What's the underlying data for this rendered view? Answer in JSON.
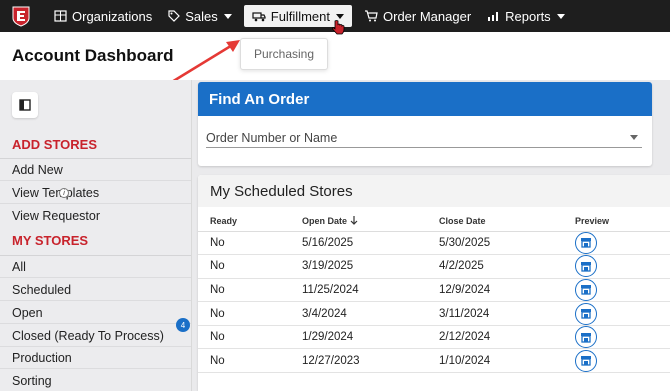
{
  "topnav": {
    "items": [
      {
        "label": "Organizations",
        "icon": "building-icon",
        "has_caret": false
      },
      {
        "label": "Sales",
        "icon": "tag-icon",
        "has_caret": true
      },
      {
        "label": "Fulfillment",
        "icon": "truck-icon",
        "has_caret": true,
        "active": true
      },
      {
        "label": "Order Manager",
        "icon": "cart-icon",
        "has_caret": false
      },
      {
        "label": "Reports",
        "icon": "chart-icon",
        "has_caret": true
      }
    ]
  },
  "dropdown": {
    "items": [
      "Purchasing"
    ]
  },
  "header": {
    "title": "Account Dashboard"
  },
  "sidebar": {
    "add_stores_heading": "ADD STORES",
    "add_stores": [
      "Add New",
      "View Templates",
      "View Requestor"
    ],
    "my_stores_heading": "MY STORES",
    "my_stores": [
      "All",
      "Scheduled",
      "Open",
      "Closed (Ready To Process)",
      "Production",
      "Sorting"
    ],
    "closed_badge": "4"
  },
  "find_order": {
    "title": "Find An Order",
    "placeholder": "Order Number or Name"
  },
  "scheduled": {
    "title": "My Scheduled Stores",
    "columns": [
      "Ready",
      "Open Date",
      "Close Date",
      "Preview"
    ],
    "rows": [
      {
        "ready": "No",
        "open": "5/16/2025",
        "close": "5/30/2025"
      },
      {
        "ready": "No",
        "open": "3/19/2025",
        "close": "4/2/2025"
      },
      {
        "ready": "No",
        "open": "11/25/2024",
        "close": "12/9/2024"
      },
      {
        "ready": "No",
        "open": "3/4/2024",
        "close": "3/11/2024"
      },
      {
        "ready": "No",
        "open": "1/29/2024",
        "close": "2/12/2024"
      },
      {
        "ready": "No",
        "open": "12/27/2023",
        "close": "1/10/2024"
      }
    ]
  },
  "colors": {
    "accent": "#1a6fc7",
    "brand_red": "#c8232c",
    "nav_bg": "#1e1e1e"
  }
}
